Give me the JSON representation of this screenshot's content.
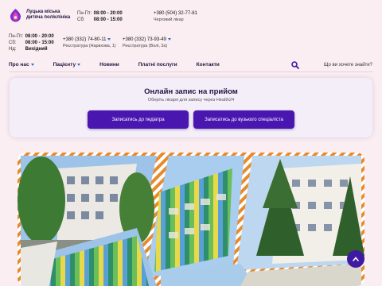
{
  "header": {
    "logo_line1": "Луцька міська",
    "logo_line2": "дитяча поліклініка",
    "hours1": [
      {
        "label": "Пн-Пт:",
        "value": "08:00 - 20:00"
      },
      {
        "label": "Сб:",
        "value": "08:00 - 15:00"
      }
    ],
    "phone1": {
      "number": "+380 (504) 32-77-81",
      "sub": "Черговий лікар"
    },
    "hours2": [
      {
        "label": "Пн-Пт:",
        "value": "08:00 - 20:00"
      },
      {
        "label": "Сб:",
        "value": "08:00 - 15:00"
      },
      {
        "label": "Нд:",
        "value": "Вихідний"
      }
    ],
    "phone2": {
      "number": "+380 (332) 74-80-11",
      "sub": "Реєстратура (Нарвхова, 1)"
    },
    "phone3": {
      "number": "+380 (332) 73-93-49",
      "sub": "Реєстратура (Волі, 3а)"
    }
  },
  "nav": {
    "items": [
      {
        "label": "Про нас",
        "dropdown": true
      },
      {
        "label": "Пацієнту",
        "dropdown": true
      },
      {
        "label": "Новини",
        "dropdown": false
      },
      {
        "label": "Платні послуги",
        "dropdown": false
      },
      {
        "label": "Контакти",
        "dropdown": false
      }
    ],
    "search_hint": "Що ви хочете знайти?"
  },
  "appointment": {
    "title": "Онлайн запис на прийом",
    "subtitle": "Оберіть лікаря для запису через Health24",
    "btn_pediatrician": "Записатись до педіатра",
    "btn_specialist": "Записатись до вузького спеціаліста"
  },
  "colors": {
    "accent": "#4a16b0",
    "bg": "#fbeef2",
    "text": "#1e1640"
  },
  "icons": [
    "logo-icon",
    "chevron-down-icon",
    "search-icon",
    "arrow-up-icon"
  ]
}
